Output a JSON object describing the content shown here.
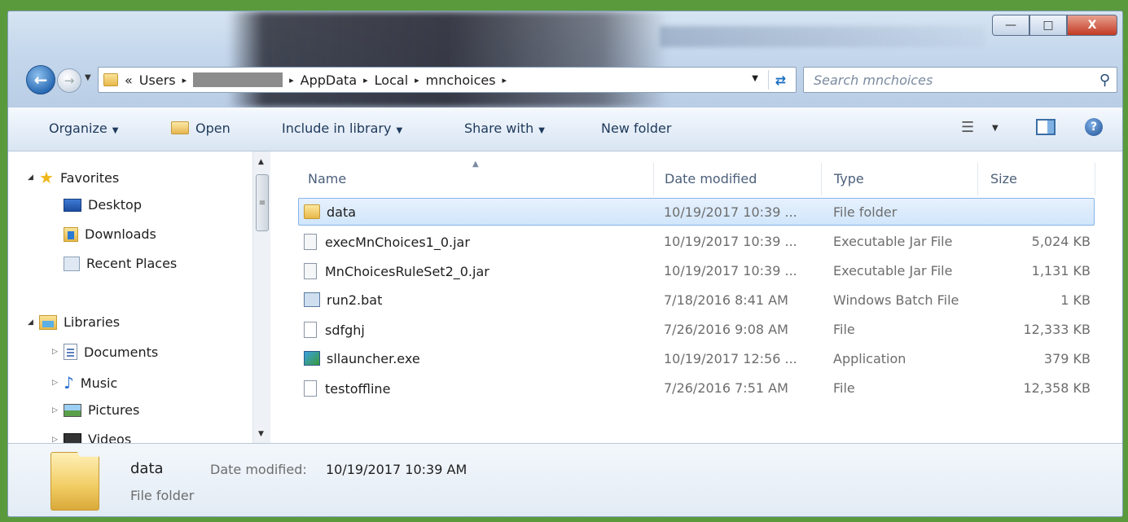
{
  "window": {
    "controls": {
      "minimize": "—",
      "maximize": "□",
      "close": "X"
    }
  },
  "address_bar": {
    "prefix": "«",
    "crumbs": [
      "Users",
      "AppData",
      "Local",
      "mnchoices"
    ],
    "separator": "▸",
    "search_placeholder": "Search mnchoices"
  },
  "toolbar": {
    "organize": "Organize",
    "open": "Open",
    "include_in_library": "Include in library",
    "share_with": "Share with",
    "new_folder": "New folder"
  },
  "nav_pane": {
    "favorites": {
      "label": "Favorites",
      "items": [
        "Desktop",
        "Downloads",
        "Recent Places"
      ]
    },
    "libraries": {
      "label": "Libraries",
      "items": [
        "Documents",
        "Music",
        "Pictures",
        "Videos"
      ]
    }
  },
  "columns": {
    "name": "Name",
    "date": "Date modified",
    "type": "Type",
    "size": "Size"
  },
  "files": [
    {
      "name": "data",
      "date": "10/19/2017 10:39 ...",
      "type": "File folder",
      "size": "",
      "icon": "folder-icon"
    },
    {
      "name": "execMnChoices1_0.jar",
      "date": "10/19/2017 10:39 ...",
      "type": "Executable Jar File",
      "size": "5,024 KB",
      "icon": "jar-icon"
    },
    {
      "name": "MnChoicesRuleSet2_0.jar",
      "date": "10/19/2017 10:39 ...",
      "type": "Executable Jar File",
      "size": "1,131 KB",
      "icon": "jar-icon"
    },
    {
      "name": "run2.bat",
      "date": "7/18/2016 8:41 AM",
      "type": "Windows Batch File",
      "size": "1 KB",
      "icon": "batch-file-icon"
    },
    {
      "name": "sdfghj",
      "date": "7/26/2016 9:08 AM",
      "type": "File",
      "size": "12,333 KB",
      "icon": "file-icon"
    },
    {
      "name": "sllauncher.exe",
      "date": "10/19/2017 12:56 ...",
      "type": "Application",
      "size": "379 KB",
      "icon": "application-icon"
    },
    {
      "name": "testoffline",
      "date": "7/26/2016 7:51 AM",
      "type": "File",
      "size": "12,358 KB",
      "icon": "file-icon"
    }
  ],
  "details": {
    "name": "data",
    "date_label": "Date modified:",
    "date_value": "10/19/2017 10:39 AM",
    "type": "File folder"
  }
}
